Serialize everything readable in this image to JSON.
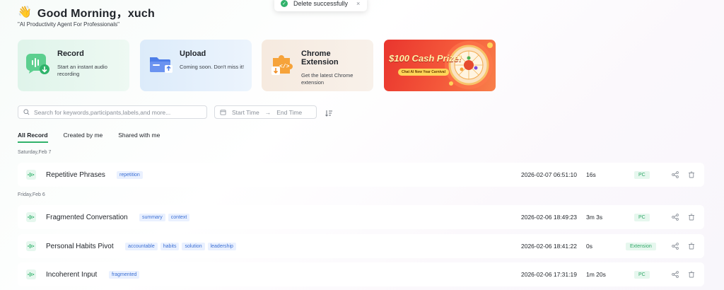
{
  "header": {
    "wave_emoji": "👋",
    "greeting": "Good Morning，xuch",
    "tagline": "\"AI Productivity Agent For Professionals\""
  },
  "toast": {
    "message": "Delete successfully",
    "close": "×"
  },
  "cards": [
    {
      "title": "Record",
      "desc": "Start an instant audio recording",
      "icon": "microphone-icon"
    },
    {
      "title": "Upload",
      "desc": "Coming soon. Don't miss it!",
      "icon": "folder-upload-icon"
    },
    {
      "title": "Chrome Extension",
      "desc": "Get the latest Chrome extension",
      "icon": "puzzle-icon"
    }
  ],
  "promo": {
    "headline": "$100 Cash Prize!",
    "subtitle": "Chat AI New Year Carnival"
  },
  "search": {
    "placeholder": "Search for keywords,participants,labels,and more..."
  },
  "date_range": {
    "start_placeholder": "Start Time",
    "end_placeholder": "End Time"
  },
  "tabs": [
    {
      "label": "All Record",
      "active": true
    },
    {
      "label": "Created by me",
      "active": false
    },
    {
      "label": "Shared with me",
      "active": false
    }
  ],
  "groups": [
    {
      "date": "Saturday,Feb 7",
      "records": [
        {
          "title": "Repetitive Phrases",
          "tags": [
            "repetition"
          ],
          "time": "2026-02-07 06:51:10",
          "duration": "16s",
          "source": "PC"
        }
      ]
    },
    {
      "date": "Friday,Feb 6",
      "records": [
        {
          "title": "Fragmented Conversation",
          "tags": [
            "summary",
            "context"
          ],
          "time": "2026-02-06 18:49:23",
          "duration": "3m 3s",
          "source": "PC"
        },
        {
          "title": "Personal Habits Pivot",
          "tags": [
            "accountable",
            "habits",
            "solution",
            "leadership"
          ],
          "time": "2026-02-06 18:41:22",
          "duration": "0s",
          "source": "Extension"
        },
        {
          "title": "Incoherent Input",
          "tags": [
            "fragmented"
          ],
          "time": "2026-02-06 17:31:19",
          "duration": "1m 20s",
          "source": "PC"
        }
      ]
    }
  ],
  "colors": {
    "accent": "#31b26b",
    "tag_text": "#3b6fd4",
    "tag_bg": "#eaf1ff"
  }
}
